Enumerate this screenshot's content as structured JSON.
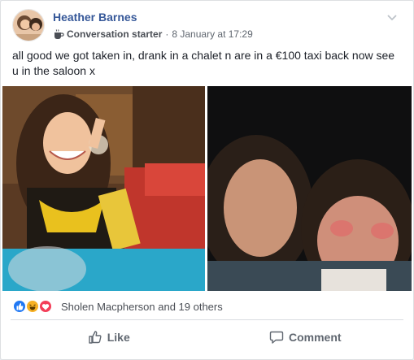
{
  "post": {
    "author": "Heather Barnes",
    "badge_label": "Conversation starter",
    "separator": "·",
    "timestamp": "8 January at 17:29",
    "text": "all good we got taken in, drank in a chalet n are in a €100 taxi back now see u in the saloon x",
    "icons": {
      "avatar": "profile-photo",
      "badge": "coffee-cup-icon",
      "menu": "chevron-down-icon"
    }
  },
  "photos": [
    {
      "name": "photo-left",
      "description_icon": "photo"
    },
    {
      "name": "photo-right",
      "description_icon": "photo"
    }
  ],
  "reactions": {
    "summary": "Sholen Macpherson and 19 others",
    "types": [
      "like",
      "haha",
      "love"
    ],
    "colors": {
      "like": "#2078f4",
      "haha": "#f7b125",
      "love": "#f33e58"
    }
  },
  "actions": {
    "like_label": "Like",
    "comment_label": "Comment"
  },
  "colors": {
    "author_link": "#365899",
    "meta_text": "#606770",
    "body_text": "#1d2129"
  }
}
